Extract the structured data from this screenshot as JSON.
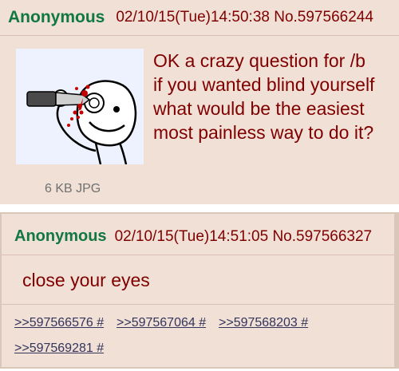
{
  "op": {
    "name": "Anonymous",
    "datetime": "02/10/15(Tue)14:50:38",
    "post_no": "No.597566244",
    "file_info": "6 KB JPG",
    "body_lines": [
      "OK a crazy question for /b",
      "if you wanted blind yourself",
      "what would be the easiest",
      "most painless way to do it?"
    ],
    "thumbnail_icon": "stick-figure-knife-eye-icon"
  },
  "reply": {
    "name": "Anonymous",
    "datetime": "02/10/15(Tue)14:51:05",
    "post_no": "No.597566327",
    "body": "close your eyes",
    "backlinks": [
      ">>597566576 #",
      ">>597567064 #",
      ">>597568203 #",
      ">>597569281 #"
    ]
  },
  "colors": {
    "post_bg": "#f0e0d6",
    "name": "#117743",
    "text": "#800000",
    "link": "#34345c",
    "thumb_bg": "#eef2ff"
  }
}
